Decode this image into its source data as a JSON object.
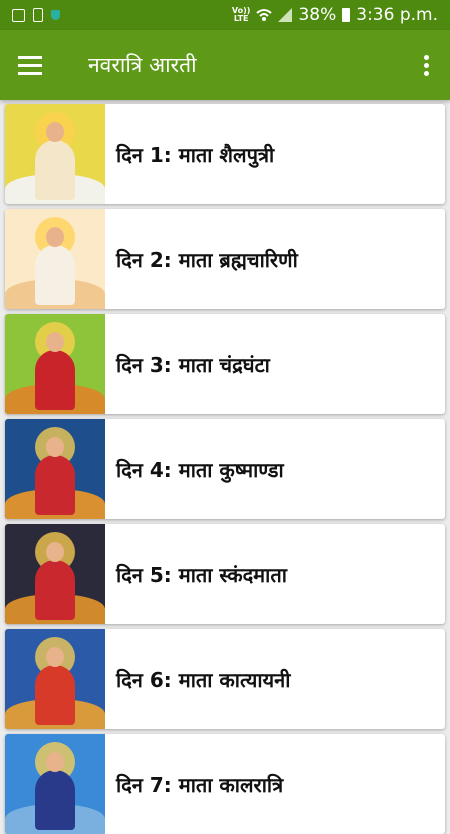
{
  "status_bar": {
    "volte_top": "Vo))",
    "volte_bottom": "LTE",
    "battery": "38%",
    "time": "3:36 p.m."
  },
  "app_bar": {
    "title": "नवरात्रि आरती"
  },
  "items": [
    {
      "label": "दिन 1: माता शैलपुत्री",
      "colors": {
        "bg": "#e8d84a",
        "body": "#f4e6c8",
        "mount": "#f2f2ea"
      }
    },
    {
      "label": "दिन 2: माता ब्रह्मचारिणी",
      "colors": {
        "bg": "#fbe9c8",
        "body": "#f6f0e4",
        "mount": "#f0c890"
      }
    },
    {
      "label": "दिन 3: माता चंद्रघंटा",
      "colors": {
        "bg": "#8ec43a",
        "body": "#c8242a",
        "mount": "#d68a2a"
      }
    },
    {
      "label": "दिन 4: माता कुष्माण्डा",
      "colors": {
        "bg": "#1e4f8c",
        "body": "#c8282e",
        "mount": "#d89030"
      }
    },
    {
      "label": "दिन 5: माता स्कंदमाता",
      "colors": {
        "bg": "#2a2a3a",
        "body": "#c8282e",
        "mount": "#d08a2c"
      }
    },
    {
      "label": "दिन 6: माता कात्यायनी",
      "colors": {
        "bg": "#2a5aa8",
        "body": "#d83a2a",
        "mount": "#d89a3a"
      }
    },
    {
      "label": "दिन 7: माता कालरात्रि",
      "colors": {
        "bg": "#3a8ad8",
        "body": "#2a3a8a",
        "mount": "#7ab0e0"
      }
    }
  ]
}
